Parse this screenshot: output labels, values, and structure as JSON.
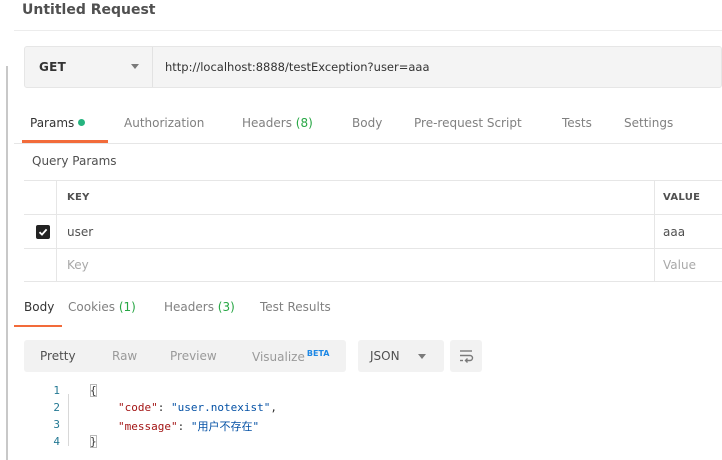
{
  "request": {
    "title": "Untitled Request",
    "method": "GET",
    "url": "http://localhost:8888/testException?user=aaa"
  },
  "request_tabs": [
    {
      "label": "Params",
      "active": true,
      "indicator": "green-dot"
    },
    {
      "label": "Authorization"
    },
    {
      "label": "Headers",
      "count": "(8)"
    },
    {
      "label": "Body"
    },
    {
      "label": "Pre-request Script"
    },
    {
      "label": "Tests"
    },
    {
      "label": "Settings"
    }
  ],
  "query_params": {
    "title": "Query Params",
    "headers": {
      "key": "KEY",
      "value": "VALUE"
    },
    "rows": [
      {
        "checked": true,
        "key": "user",
        "value": "aaa"
      }
    ],
    "placeholder": {
      "key": "Key",
      "value": "Value"
    }
  },
  "response_tabs": [
    {
      "label": "Body",
      "active": true
    },
    {
      "label": "Cookies",
      "count": "(1)"
    },
    {
      "label": "Headers",
      "count": "(3)"
    },
    {
      "label": "Test Results"
    }
  ],
  "response_toolbar": {
    "views": [
      "Pretty",
      "Raw",
      "Preview",
      "Visualize"
    ],
    "beta_label": "BETA",
    "active_view": "Pretty",
    "format": "JSON"
  },
  "response_body": {
    "line_numbers": [
      "1",
      "2",
      "3",
      "4"
    ],
    "open_brace": "{",
    "close_brace": "}",
    "fields": [
      {
        "key": "\"code\"",
        "value": "\"user.notexist\"",
        "comma": ","
      },
      {
        "key": "\"message\"",
        "value": "\"用户不存在\"",
        "comma": ""
      }
    ]
  },
  "colors": {
    "accent": "#f26b3a",
    "count_green": "#28a745",
    "dot_green": "#26b47f",
    "json_key": "#a31515",
    "json_string": "#0451a5",
    "beta_blue": "#1e88e5"
  }
}
